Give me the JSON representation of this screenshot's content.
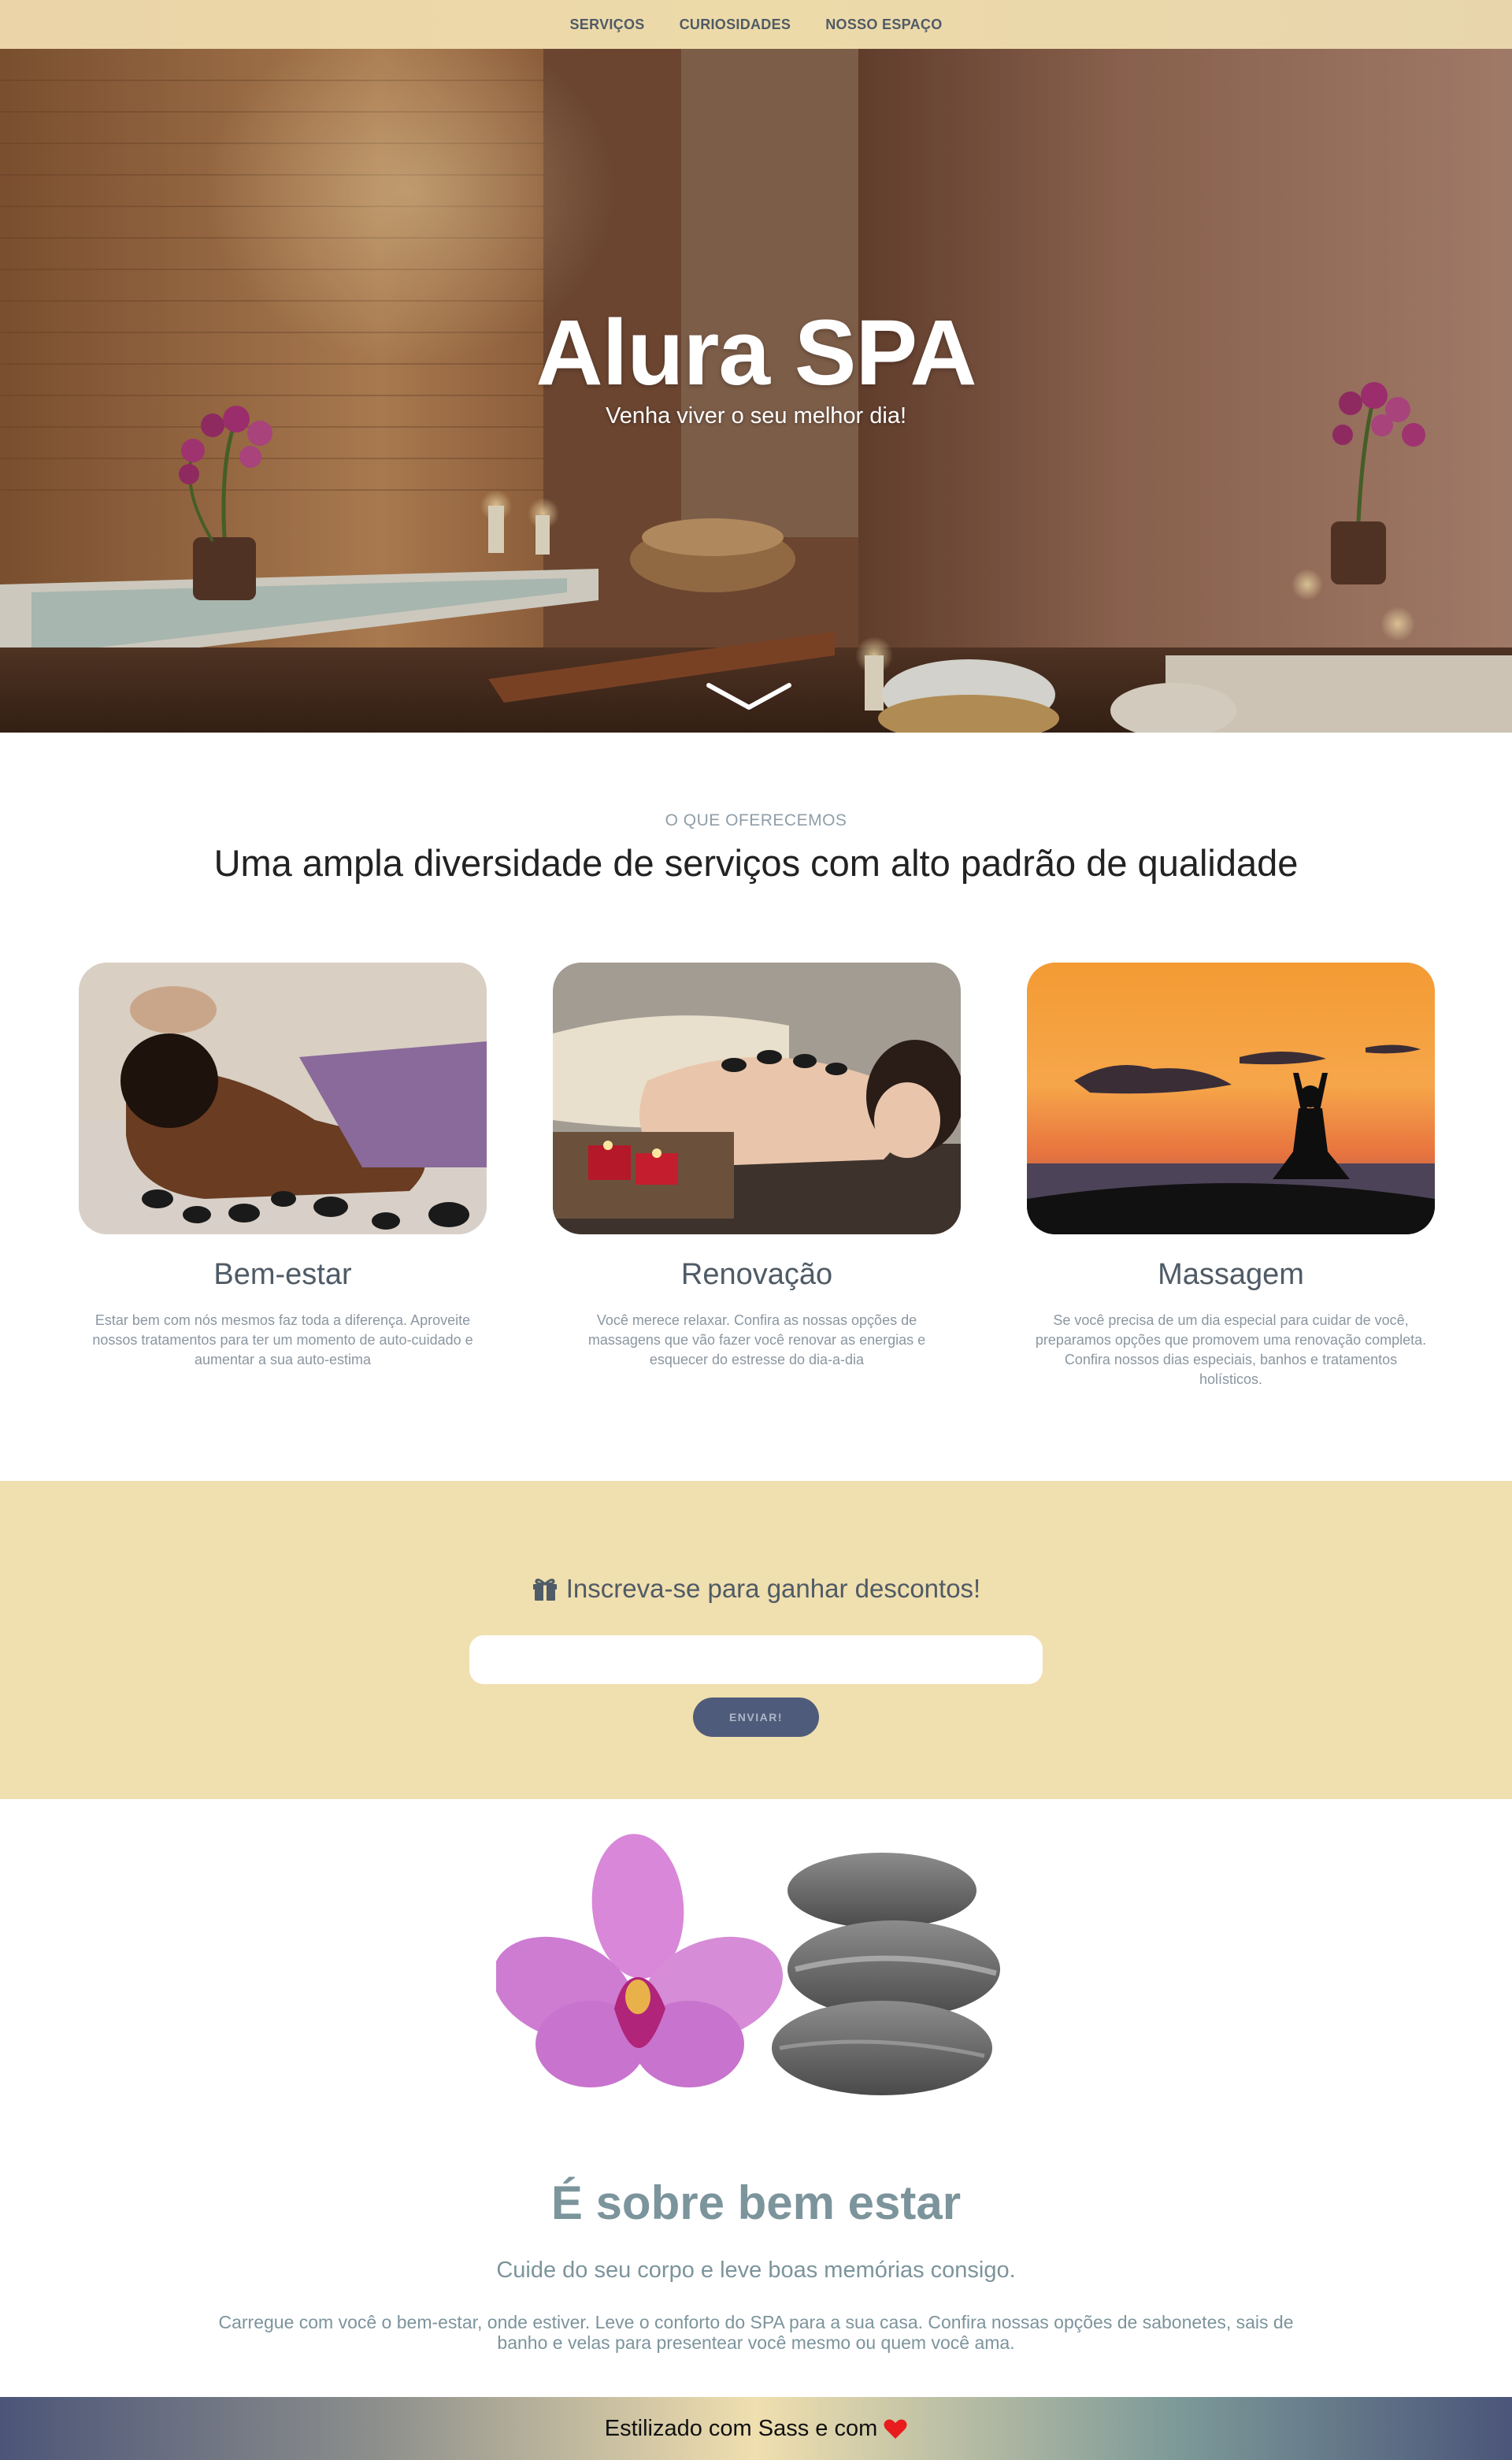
{
  "nav": {
    "items": [
      {
        "label": "SERVIÇOS"
      },
      {
        "label": "CURIOSIDADES"
      },
      {
        "label": "NOSSO ESPAÇO"
      }
    ]
  },
  "hero": {
    "title": "Alura SPA",
    "subtitle": "Venha viver o seu melhor dia!",
    "scroll_icon": "chevron-down-icon"
  },
  "services": {
    "kicker": "O QUE OFERECEMOS",
    "heading": "Uma ampla diversidade de serviços com alto padrão de qualidade",
    "cards": [
      {
        "title": "Bem-estar",
        "text": "Estar bem com nós mesmos faz toda a diferença. Aproveite nossos tratamentos para ter um momento de auto-cuidado e aumentar a sua auto-estima"
      },
      {
        "title": "Renovação",
        "text": "Você merece relaxar. Confira as nossas opções de massagens que vão fazer você renovar as energias e esquecer do estresse do dia-a-dia"
      },
      {
        "title": "Massagem",
        "text": "Se você precisa de um dia especial para cuidar de você, preparamos opções que promovem uma renovação completa. Confira nossos dias especiais, banhos e tratamentos holísticos."
      }
    ]
  },
  "subscribe": {
    "icon": "gift-icon",
    "title": "Inscreva-se para ganhar descontos!",
    "input_value": "",
    "button_label": "ENVIAR!"
  },
  "wellness": {
    "title": "É sobre bem estar",
    "subtitle": "Cuide do seu corpo e leve boas memórias consigo.",
    "text": "Carregue com você o bem-estar, onde estiver. Leve o conforto do SPA para a sua casa. Confira nossas opções de sabonetes, sais de banho e velas para presentear você mesmo ou quem você ama."
  },
  "footer": {
    "text": "Estilizado com Sass e com",
    "icon": "heart-icon",
    "heart_color": "#e81c1c"
  },
  "colors": {
    "nav_bg": "#ecd7a9",
    "subscribe_bg": "#f0dfaf",
    "button_bg": "#4f5b7a",
    "text_slate": "#4f5b66",
    "text_muted": "#7c949c"
  }
}
